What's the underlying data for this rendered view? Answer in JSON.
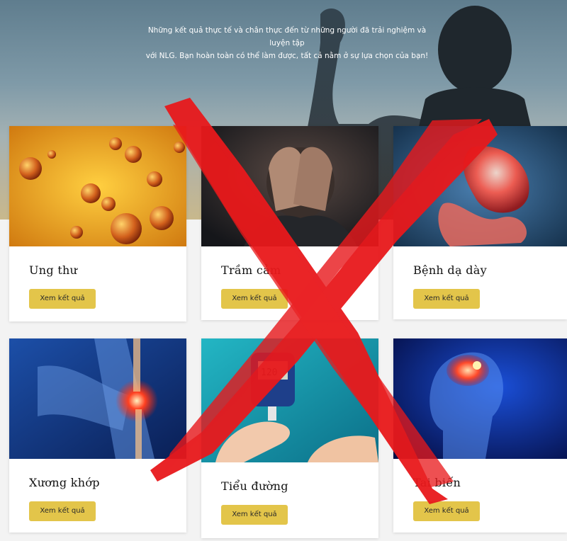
{
  "hero": {
    "line1": "Những kết quả thực tế và chân thực đến từ những người đã trải nghiệm và luyện tập",
    "line2": "với NLG. Bạn hoàn toàn có thể làm được, tất cả nằm ở sự lựa chọn của bạn!"
  },
  "cards": [
    {
      "title": "Ung thư",
      "button": "Xem kết quả",
      "image": "cancer-cells-image"
    },
    {
      "title": "Trầm cảm",
      "button": "Xem kết quả",
      "image": "depressed-man-image"
    },
    {
      "title": "Bệnh dạ dày",
      "button": "Xem kết quả",
      "image": "stomach-anatomy-image"
    },
    {
      "title": "Xương khớp",
      "button": "Xem kết quả",
      "image": "knee-joint-image"
    },
    {
      "title": "Tiểu đường",
      "button": "Xem kết quả",
      "image": "glucose-meter-image"
    },
    {
      "title": "Tai biến",
      "button": "Xem kết quả",
      "image": "brain-stroke-image"
    }
  ],
  "overlay": {
    "mark": "red-x-mark",
    "color": "#e8191c"
  },
  "colors": {
    "button": "#e3c54a",
    "card": "#ffffff"
  }
}
